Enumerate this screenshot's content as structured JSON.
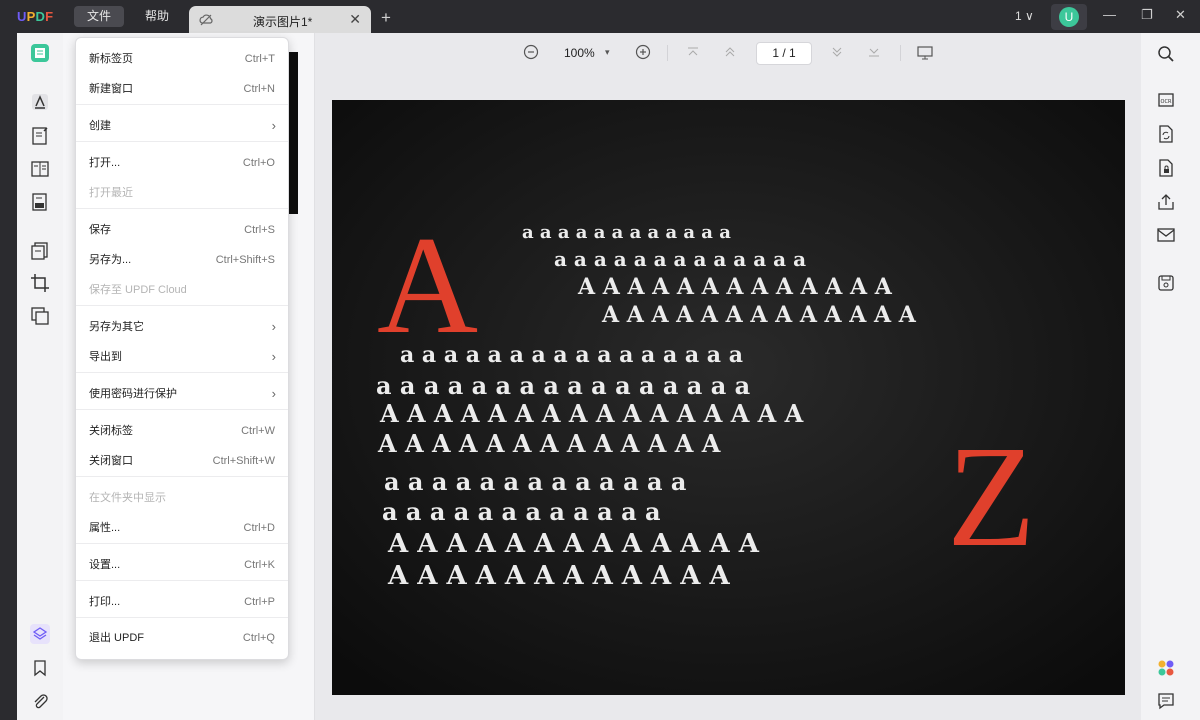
{
  "app": {
    "logo": [
      "U",
      "P",
      "D",
      "F"
    ],
    "logo_colors": [
      "#6f5cf6",
      "#f2b12f",
      "#3cc79a",
      "#e8573f"
    ],
    "menu_file": "文件",
    "menu_help": "帮助",
    "tab_title": "演示图片1*",
    "tab_close": "✕",
    "new_tab": "+",
    "page_count": "1 ∨",
    "avatar_initial": "U",
    "win_min": "—",
    "win_max": "❐",
    "win_close": "✕"
  },
  "toolbar": {
    "zoom_out": "⊖",
    "zoom": "100%",
    "zoom_dropdown": "▾",
    "zoom_in": "⊕",
    "page_input": "1  /  1"
  },
  "dropdown": {
    "items": [
      {
        "label": "新标签页",
        "shortcut": "Ctrl+T"
      },
      {
        "label": "新建窗口",
        "shortcut": "Ctrl+N"
      },
      {
        "label": "创建",
        "submenu": "›"
      },
      {
        "label": "打开...",
        "shortcut": "Ctrl+O"
      },
      {
        "label": "打开最近",
        "disabled": true
      },
      {
        "label": "保存",
        "shortcut": "Ctrl+S"
      },
      {
        "label": "另存为...",
        "shortcut": "Ctrl+Shift+S"
      },
      {
        "label": "保存至 UPDF Cloud",
        "disabled": true
      },
      {
        "label": "另存为其它",
        "submenu": "›"
      },
      {
        "label": "导出到",
        "submenu": "›"
      },
      {
        "label": "使用密码进行保护",
        "submenu": "›"
      },
      {
        "label": "关闭标签",
        "shortcut": "Ctrl+W"
      },
      {
        "label": "关闭窗口",
        "shortcut": "Ctrl+Shift+W"
      },
      {
        "label": "在文件夹中显示",
        "disabled": true
      },
      {
        "label": "属性...",
        "shortcut": "Ctrl+D"
      },
      {
        "label": "设置...",
        "shortcut": "Ctrl+K"
      },
      {
        "label": "打印...",
        "shortcut": "Ctrl+P"
      },
      {
        "label": "退出 UPDF",
        "shortcut": "Ctrl+Q"
      }
    ]
  },
  "image": {
    "big_letter_a": "A",
    "big_letter_z": "Z",
    "rows": [
      "a a a a a a a a a a a a",
      "a a a a a a a a a a a a a",
      "A A A A A A A A A A A A A",
      "A A A A A A A A A A A A A",
      "a a a a a a a a a a a a a a a a",
      "a a a a a a a a a a a a a a a a",
      "A A A A A A A A A A A A A A A A",
      "A A A A A A A A A A A A A",
      "a a a a a a a a a a a a a",
      "a a a a a a a a a a a a",
      "A A A A A A A A A A A A A",
      "A A A A A A A A A A A A"
    ],
    "accent": "#e0402c"
  }
}
